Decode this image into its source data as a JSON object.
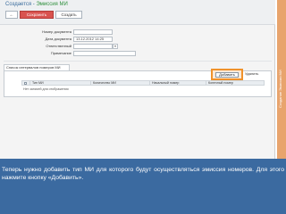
{
  "header": {
    "title_prefix": "Создается",
    "title_sep": " - ",
    "title_entity": "Эмиссия МИ",
    "back_icon": "arrow-left-icon",
    "back_label": "←",
    "save_label": "Сохранить",
    "create_label": "Создать"
  },
  "form": {
    "doc_number_label": "Номер документа",
    "doc_number_value": "",
    "doc_date_label": "Дата документа",
    "doc_date_value": "13.12.2012 14:25",
    "responsible_label": "Ответственный",
    "responsible_value": "",
    "note_label": "Примечание",
    "note_value": ""
  },
  "tabs": [
    {
      "label": "Список интервалов номеров МИ"
    }
  ],
  "actions": {
    "add_label": "Добавить",
    "delete_label": "Удалить"
  },
  "grid": {
    "columns": [
      "Тип МИ",
      "Количество МИ",
      "Начальный номер",
      "Конечный номер"
    ],
    "empty_text": "Нет записей для отображения"
  },
  "sidebar": {
    "label": "Создание Эмиссии МИ"
  },
  "caption": {
    "text": "Теперь нужно добавить тип МИ для которого будут осуществляться эмиссия номеров. Для этого нажмите кнопку «Добавить»."
  },
  "colors": {
    "accent_title": "#3c6e9e",
    "accent_entity": "#2d8f3c",
    "save_button": "#d9534f",
    "highlight": "#f0922b",
    "caption_bg": "#3b6aa0",
    "sidebar": "#e8a46d"
  }
}
